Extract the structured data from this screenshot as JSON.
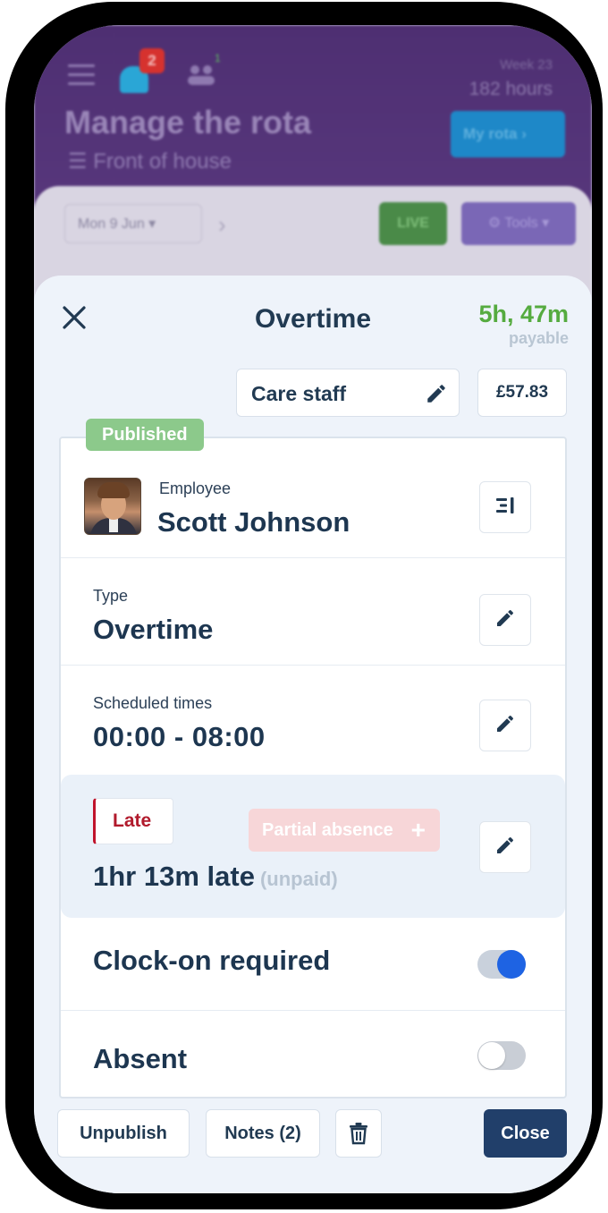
{
  "background": {
    "notifications_count": "2",
    "people_count": "1",
    "week_label": "Week 23",
    "hours_label": "182 hours",
    "title": "Manage the rota",
    "subtitle": "Front of house",
    "my_rota_label": "My rota",
    "date_label": "Mon 9 Jun",
    "live_label": "LIVE",
    "tools_label": "Tools"
  },
  "modal": {
    "title": "Overtime",
    "payable_value": "5h, 47m",
    "payable_label": "payable",
    "role": "Care staff",
    "cost": "£57.83",
    "status_badge": "Published",
    "employee": {
      "label": "Employee",
      "name": "Scott Johnson"
    },
    "type": {
      "label": "Type",
      "value": "Overtime"
    },
    "scheduled": {
      "label": "Scheduled times",
      "value": "00:00 - 08:00"
    },
    "late": {
      "tag": "Late",
      "value": "1hr 13m late",
      "note": "(unpaid)"
    },
    "clock_on": {
      "label": "Clock-on required",
      "enabled": true
    },
    "absent": {
      "label": "Absent",
      "partial_label": "Partial absence",
      "enabled": false
    }
  },
  "footer": {
    "unpublish_label": "Unpublish",
    "notes_label": "Notes (2)",
    "close_label": "Close"
  },
  "colors": {
    "header_purple": "#4e2f72",
    "payable_green": "#55ab3f",
    "published_green": "#8cc98b",
    "late_red": "#b11a2c",
    "toggle_blue": "#1e63e3",
    "close_navy": "#213f6a"
  }
}
